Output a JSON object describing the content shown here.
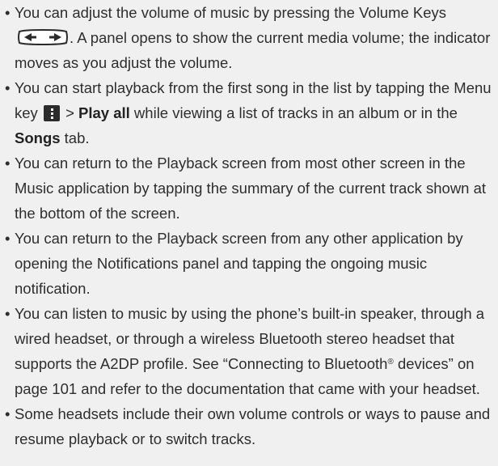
{
  "bullets": [
    {
      "part1": "You can adjust the volume of music by pressing the Volume Keys ",
      "icon": "volume-keys-icon",
      "part2": ". A panel opens to show the current media volume; the indicator moves as you adjust the volume."
    },
    {
      "part1": "You can start playback from the first song in the list by tapping the Menu key ",
      "icon": "menu-key-icon",
      "part2": " > ",
      "bold1": "Play all",
      "part3": " while viewing a list of tracks in an album or in the ",
      "bold2": "Songs",
      "part4": " tab."
    },
    {
      "text": "You can return to the Playback screen from most other screen in the Music application by tapping the summary of the current track shown at the bottom of the screen."
    },
    {
      "text": "You can return to the Playback screen from any other application by opening the Notifications panel and tapping the ongoing music notification."
    },
    {
      "part1": "You can listen to music by using the phone’s built-in speaker, through a wired headset, or through a wireless Bluetooth stereo headset that supports the A2DP profile. See “Connecting to Bluetooth",
      "sup": "®",
      "part2": " devices” on page 101 and refer to the documentation that came with your headset."
    },
    {
      "text": "Some headsets include their own volume controls or ways to pause and resume playback or to switch tracks."
    }
  ],
  "colors": {
    "background": "#f0f0f0",
    "text": "#2e2e2e",
    "icon_dark": "#2b2b2b"
  }
}
